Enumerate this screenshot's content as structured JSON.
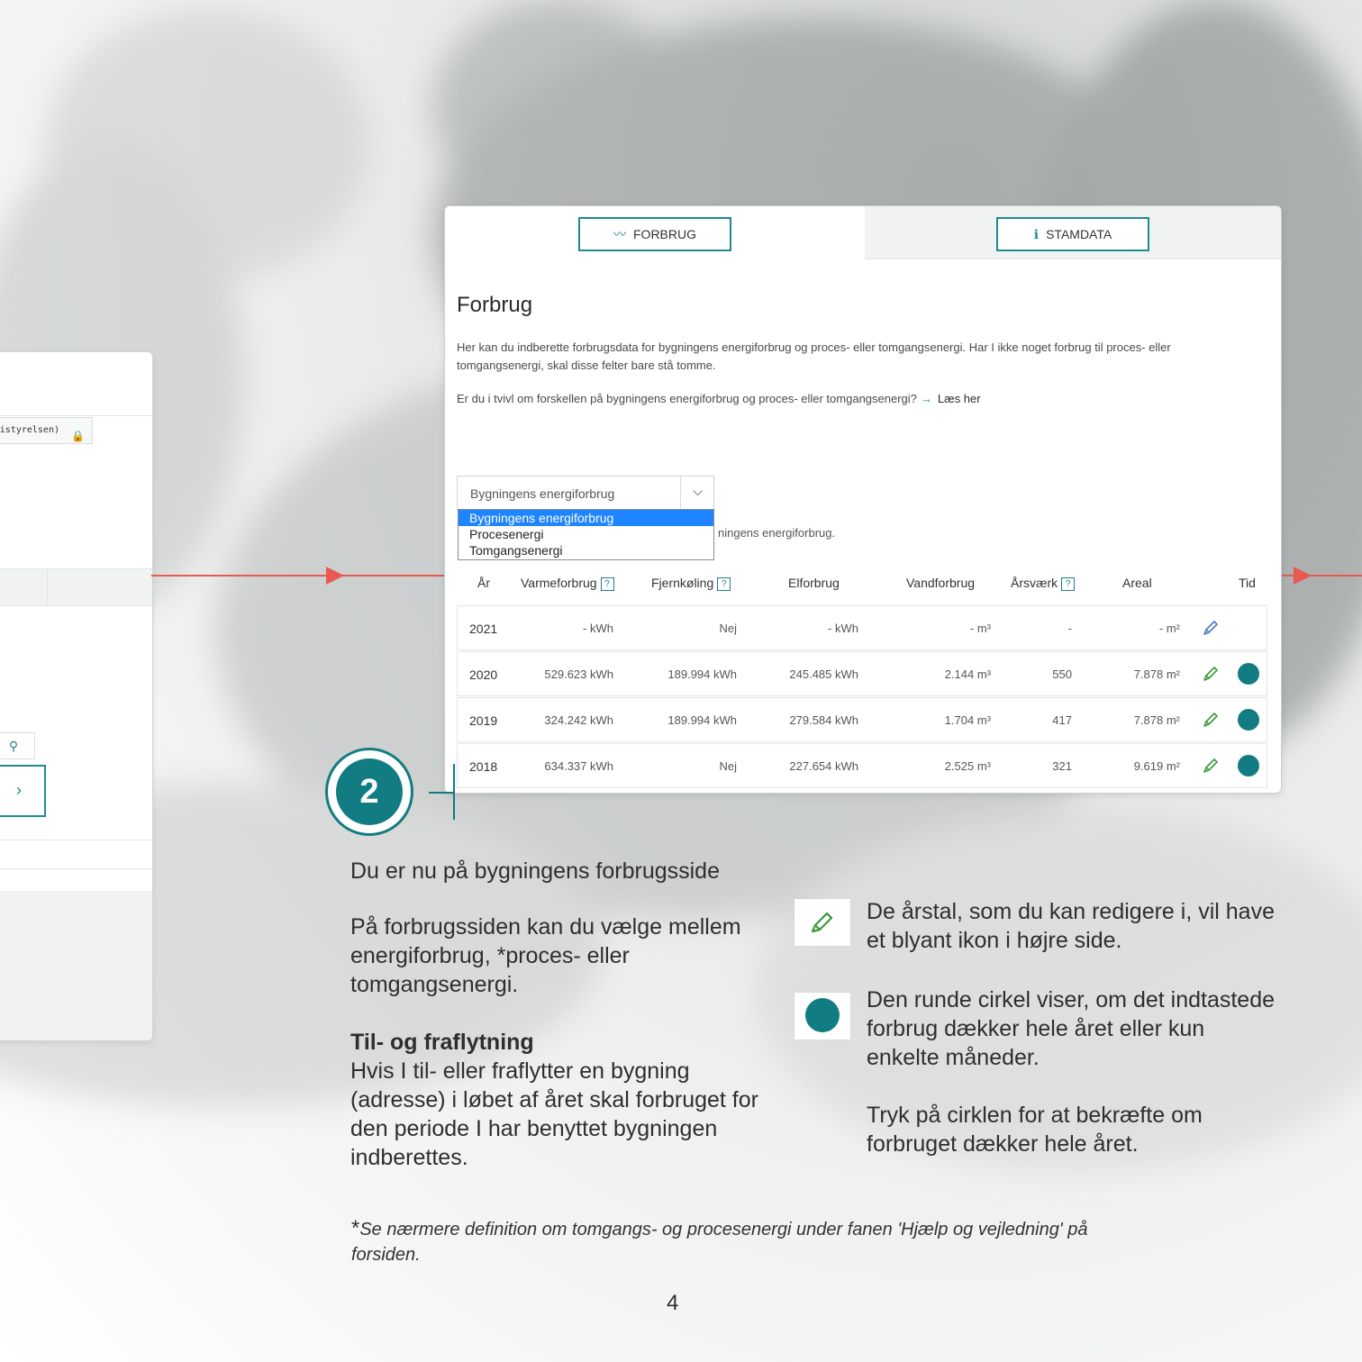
{
  "left_window": {
    "tag_text": "rgistyrelsen)"
  },
  "tabs": [
    {
      "label": "FORBRUG",
      "icon": "chart-line-icon"
    },
    {
      "label": "STAMDATA",
      "icon": "info-icon"
    }
  ],
  "page": {
    "title": "Forbrug",
    "intro": "Her kan du indberette forbrugsdata for bygningens energiforbrug og proces- eller tomgangsenergi. Har I ikke noget forbrug til proces- eller tomgangsenergi, skal disse felter bare stå tomme.",
    "question": "Er du i tvivl om forskellen på bygningens energiforbrug og proces- eller tomgangsenergi?",
    "link": "Læs her"
  },
  "select": {
    "value": "Bygningens energiforbrug",
    "options": [
      "Bygningens energiforbrug",
      "Procesenergi",
      "Tomgangsenergi"
    ],
    "hidden_text": "ningens energiforbrug."
  },
  "table": {
    "headers": [
      "År",
      "Varmeforbrug",
      "Fjernkøling",
      "Elforbrug",
      "Vandforbrug",
      "Årsværk",
      "Areal",
      "Tid"
    ],
    "rows": [
      {
        "year": "2021",
        "varme": "- kWh",
        "fjern": "Nej",
        "el": "- kWh",
        "vand": "- m³",
        "aarsvaerk": "-",
        "areal": "- m²",
        "pencil_color": "#4a78c8",
        "dot": false
      },
      {
        "year": "2020",
        "varme": "529.623 kWh",
        "fjern": "189.994 kWh",
        "el": "245.485 kWh",
        "vand": "2.144 m³",
        "aarsvaerk": "550",
        "areal": "7.878 m²",
        "pencil_color": "#3a9a3a",
        "dot": true
      },
      {
        "year": "2019",
        "varme": "324.242 kWh",
        "fjern": "189.994 kWh",
        "el": "279.584 kWh",
        "vand": "1.704 m³",
        "aarsvaerk": "417",
        "areal": "7.878 m²",
        "pencil_color": "#3a9a3a",
        "dot": true
      },
      {
        "year": "2018",
        "varme": "634.337 kWh",
        "fjern": "Nej",
        "el": "227.654 kWh",
        "vand": "2.525 m³",
        "aarsvaerk": "321",
        "areal": "9.619 m²",
        "pencil_color": "#3a9a3a",
        "dot": true
      }
    ]
  },
  "step": {
    "number": "2"
  },
  "texts": {
    "heading": "Du er nu på bygningens forbrugsside",
    "p1": "På forbrugssiden kan du vælge mellem energiforbrug, *proces- eller tomgangsenergi.",
    "sub_heading": "Til- og fraflytning",
    "p2": "Hvis I til- eller fraflytter en bygning (adresse) i løbet af året skal forbruget for den periode I har benyttet bygningen indberettes.",
    "pencil_text": "De årstal, som du kan redigere i, vil have et blyant ikon i højre side.",
    "circle_text": "Den runde cirkel viser, om det indtastede forbrug dækker hele året eller kun enkelte måneder.",
    "confirm_text": "Tryk på cirklen for at bekræfte om forbruget dækker hele året."
  },
  "footnote": "Se nærmere definition om tomgangs- og procesenergi under fanen 'Hjælp og vejledning' på forsiden.",
  "page_number": "4",
  "colors": {
    "teal": "#127c83",
    "accent_red": "#e85a4f",
    "select_blue": "#1f84ff"
  }
}
